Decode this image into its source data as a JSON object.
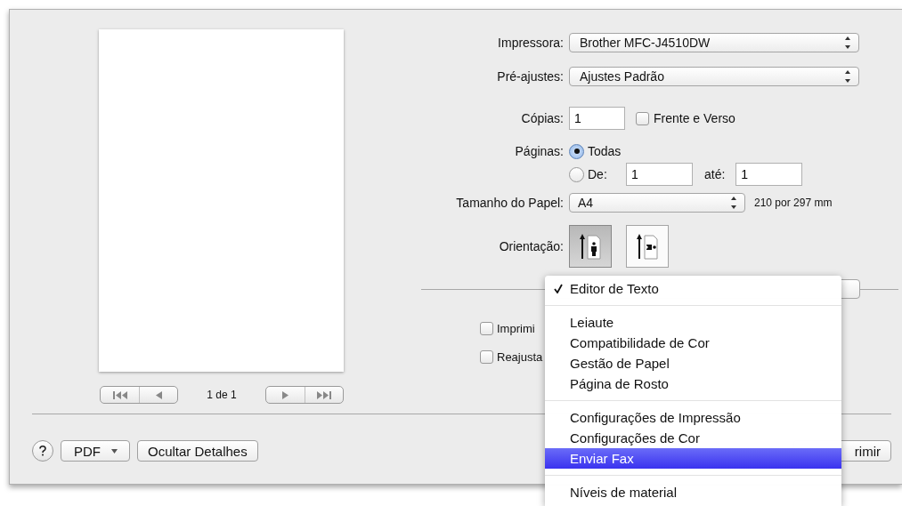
{
  "print_dialog": {
    "preview": {
      "page_counter": "1 de 1"
    },
    "printer": {
      "label": "Impressora:",
      "value": "Brother MFC-J4510DW"
    },
    "presets": {
      "label": "Pré-ajustes:",
      "value": "Ajustes Padrão"
    },
    "copies": {
      "label": "Cópias:",
      "value": "1"
    },
    "two_sided": {
      "label": "Frente e Verso",
      "checked": false
    },
    "pages": {
      "label": "Páginas:",
      "options": [
        {
          "label": "Todas",
          "selected": true
        },
        {
          "label": "De:",
          "selected": false
        }
      ],
      "from": "1",
      "to_label": "até:",
      "to": "1"
    },
    "paper_size": {
      "label": "Tamanho do Papel:",
      "value": "A4",
      "dimensions": "210 por 297 mm"
    },
    "orientation": {
      "label": "Orientação:",
      "options": [
        {
          "kind": "portrait",
          "selected": true
        },
        {
          "kind": "landscape",
          "selected": false
        }
      ]
    },
    "options": [
      {
        "label": "Imprimi",
        "checked": false
      },
      {
        "label": "Reajusta",
        "checked": false
      }
    ],
    "buttons": {
      "pdf": "PDF",
      "hide_details": "Ocultar Detalhes",
      "print": "rimir"
    }
  },
  "panel_menu": {
    "sections": [
      [
        {
          "label": "Editor de Texto",
          "checked": true,
          "selected": false
        }
      ],
      [
        {
          "label": "Leiaute",
          "checked": false,
          "selected": false
        },
        {
          "label": "Compatibilidade de Cor",
          "checked": false,
          "selected": false
        },
        {
          "label": "Gestão de Papel",
          "checked": false,
          "selected": false
        },
        {
          "label": "Página de Rosto",
          "checked": false,
          "selected": false
        }
      ],
      [
        {
          "label": "Configurações de Impressão",
          "checked": false,
          "selected": false
        },
        {
          "label": "Configurações de Cor",
          "checked": false,
          "selected": false
        },
        {
          "label": "Enviar Fax",
          "checked": false,
          "selected": true
        }
      ],
      [
        {
          "label": "Níveis de material",
          "checked": false,
          "selected": false
        }
      ]
    ]
  }
}
